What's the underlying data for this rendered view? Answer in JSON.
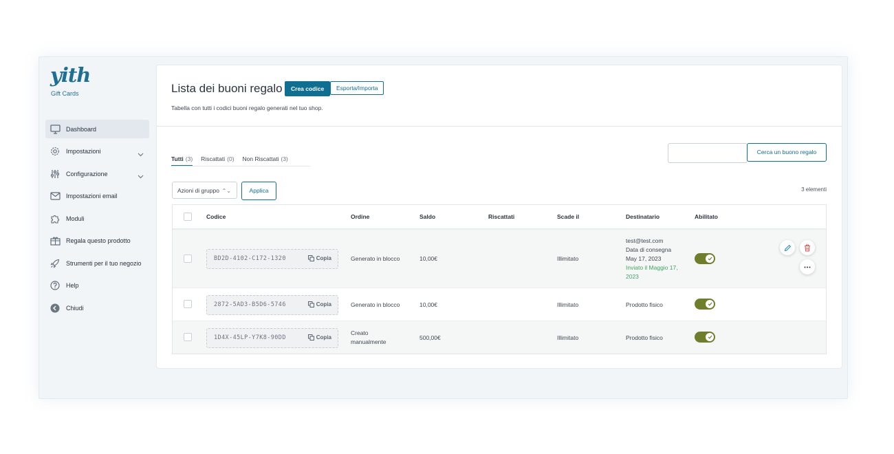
{
  "brand": {
    "logo_text": "yith",
    "subtitle": "Gift Cards"
  },
  "sidebar": {
    "items": [
      {
        "label": "Dashboard",
        "icon": "monitor-icon",
        "active": true
      },
      {
        "label": "Impostazioni",
        "icon": "gear-icon",
        "expandable": true
      },
      {
        "label": "Configurazione",
        "icon": "sliders-icon",
        "expandable": true
      },
      {
        "label": "Impostazioni email",
        "icon": "envelope-icon"
      },
      {
        "label": "Moduli",
        "icon": "puzzle-icon"
      },
      {
        "label": "Regala questo prodotto",
        "icon": "gift-icon"
      },
      {
        "label": "Strumenti per il tuo negozio",
        "icon": "rocket-icon"
      },
      {
        "label": "Help",
        "icon": "help-circle-icon"
      },
      {
        "label": "Chiudi",
        "icon": "arrow-left-circle-icon"
      }
    ]
  },
  "header": {
    "title": "Lista dei buoni regalo",
    "create_button": "Crea codice",
    "export_button": "Esporta/Importa",
    "subtitle": "Tabella con tutti i codici buoni regalo generati nel tuo shop."
  },
  "tabs": [
    {
      "label": "Tutti",
      "count": "(3)",
      "active": true
    },
    {
      "label": "Riscattati",
      "count": "(0)"
    },
    {
      "label": "Non Riscattati",
      "count": "(3)"
    }
  ],
  "search": {
    "placeholder": "",
    "button": "Cerca un buono regalo"
  },
  "bulk": {
    "select_label": "Azioni di gruppo",
    "apply_label": "Applica"
  },
  "count_text": "3 elementi",
  "table": {
    "columns": {
      "code": "Codice",
      "order": "Ordine",
      "balance": "Saldo",
      "redeemed": "Riscattati",
      "expires": "Scade il",
      "recipient": "Destinatario",
      "enabled": "Abilitato"
    },
    "copy_label": "Copia",
    "rows": [
      {
        "code": "BD2D-4102-C172-1320",
        "order": "Generato in blocco",
        "balance": "10,00€",
        "redeemed": "",
        "expires": "Illimitato",
        "recipient_lines": [
          "test@test.com",
          "Data di consegna",
          "May 17, 2023"
        ],
        "recipient_status": "Inviato il Maggio 17, 2023",
        "enabled": true
      },
      {
        "code": "2872-5AD3-B5D6-5746",
        "order": "Generato in blocco",
        "balance": "10,00€",
        "redeemed": "",
        "expires": "Illimitato",
        "recipient_lines": [
          "Prodotto fisico"
        ],
        "recipient_status": "",
        "enabled": true
      },
      {
        "code": "1D4X-45LP-Y7K8-90DD",
        "order": "Creato manualmente",
        "balance": "500,00€",
        "redeemed": "",
        "expires": "Illimitato",
        "recipient_lines": [
          "Prodotto fisico"
        ],
        "recipient_status": "",
        "enabled": true
      }
    ]
  },
  "colors": {
    "accent": "#0e6f92",
    "toggle_on": "#6e7f2c",
    "sent_status": "#3fa35f",
    "delete": "#d9534f"
  }
}
